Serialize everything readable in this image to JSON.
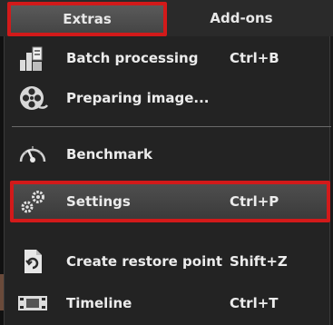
{
  "menubar": {
    "tabs": [
      {
        "label": "Extras",
        "selected": true
      },
      {
        "label": "Add-ons",
        "selected": false
      }
    ]
  },
  "menu": {
    "items": [
      {
        "label": "Batch processing",
        "shortcut": "Ctrl+B",
        "icon": "batch-processing-icon"
      },
      {
        "label": "Preparing image...",
        "shortcut": "",
        "icon": "film-reel-icon"
      },
      {
        "label": "Benchmark",
        "shortcut": "",
        "icon": "speedometer-icon"
      },
      {
        "label": "Settings",
        "shortcut": "Ctrl+P",
        "icon": "gears-icon",
        "highlighted": true
      },
      {
        "label": "Create restore point",
        "shortcut": "Shift+Z",
        "icon": "restore-point-icon"
      },
      {
        "label": "Timeline",
        "shortcut": "Ctrl+T",
        "icon": "timeline-icon"
      }
    ]
  },
  "colors": {
    "highlight_border": "#d21a1a",
    "background": "#232323",
    "text": "#ececec"
  }
}
